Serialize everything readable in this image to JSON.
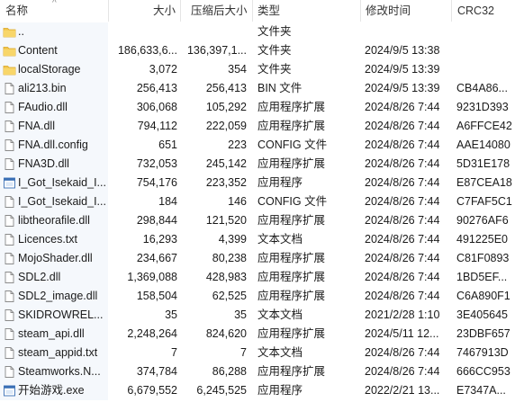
{
  "columns": {
    "name": "名称",
    "size": "大小",
    "compressed": "压缩后大小",
    "type": "类型",
    "modified": "修改时间",
    "crc": "CRC32"
  },
  "files": [
    {
      "name": "..",
      "size": "",
      "compressed": "",
      "type": "文件夹",
      "modified": "",
      "crc": "",
      "icon": "folder-icon"
    },
    {
      "name": "Content",
      "size": "186,633,6...",
      "compressed": "136,397,1...",
      "type": "文件夹",
      "modified": "2024/9/5 13:38",
      "crc": "",
      "icon": "folder-icon"
    },
    {
      "name": "localStorage",
      "size": "3,072",
      "compressed": "354",
      "type": "文件夹",
      "modified": "2024/9/5 13:39",
      "crc": "",
      "icon": "folder-icon"
    },
    {
      "name": "ali213.bin",
      "size": "256,413",
      "compressed": "256,413",
      "type": "BIN 文件",
      "modified": "2024/9/5 13:39",
      "crc": "CB4A86...",
      "icon": "file-icon"
    },
    {
      "name": "FAudio.dll",
      "size": "306,068",
      "compressed": "105,292",
      "type": "应用程序扩展",
      "modified": "2024/8/26 7:44",
      "crc": "9231D393",
      "icon": "file-icon"
    },
    {
      "name": "FNA.dll",
      "size": "794,112",
      "compressed": "222,059",
      "type": "应用程序扩展",
      "modified": "2024/8/26 7:44",
      "crc": "A6FFCE42",
      "icon": "file-icon"
    },
    {
      "name": "FNA.dll.config",
      "size": "651",
      "compressed": "223",
      "type": "CONFIG 文件",
      "modified": "2024/8/26 7:44",
      "crc": "AAE14080",
      "icon": "file-icon"
    },
    {
      "name": "FNA3D.dll",
      "size": "732,053",
      "compressed": "245,142",
      "type": "应用程序扩展",
      "modified": "2024/8/26 7:44",
      "crc": "5D31E178",
      "icon": "file-icon"
    },
    {
      "name": "I_Got_Isekaid_I...",
      "size": "754,176",
      "compressed": "223,352",
      "type": "应用程序",
      "modified": "2024/8/26 7:44",
      "crc": "E87CEA18",
      "icon": "exe-icon"
    },
    {
      "name": "I_Got_Isekaid_I...",
      "size": "184",
      "compressed": "146",
      "type": "CONFIG 文件",
      "modified": "2024/8/26 7:44",
      "crc": "C7FAF5C1",
      "icon": "file-icon"
    },
    {
      "name": "libtheorafile.dll",
      "size": "298,844",
      "compressed": "121,520",
      "type": "应用程序扩展",
      "modified": "2024/8/26 7:44",
      "crc": "90276AF6",
      "icon": "file-icon"
    },
    {
      "name": "Licences.txt",
      "size": "16,293",
      "compressed": "4,399",
      "type": "文本文档",
      "modified": "2024/8/26 7:44",
      "crc": "491225E0",
      "icon": "file-icon"
    },
    {
      "name": "MojoShader.dll",
      "size": "234,667",
      "compressed": "80,238",
      "type": "应用程序扩展",
      "modified": "2024/8/26 7:44",
      "crc": "C81F0893",
      "icon": "file-icon"
    },
    {
      "name": "SDL2.dll",
      "size": "1,369,088",
      "compressed": "428,983",
      "type": "应用程序扩展",
      "modified": "2024/8/26 7:44",
      "crc": "1BD5EF...",
      "icon": "file-icon"
    },
    {
      "name": "SDL2_image.dll",
      "size": "158,504",
      "compressed": "62,525",
      "type": "应用程序扩展",
      "modified": "2024/8/26 7:44",
      "crc": "C6A890F1",
      "icon": "file-icon"
    },
    {
      "name": "SKIDROWREL...",
      "size": "35",
      "compressed": "35",
      "type": "文本文档",
      "modified": "2021/2/28 1:10",
      "crc": "3E405645",
      "icon": "file-icon"
    },
    {
      "name": "steam_api.dll",
      "size": "2,248,264",
      "compressed": "824,620",
      "type": "应用程序扩展",
      "modified": "2024/5/11 12...",
      "crc": "23DBF657",
      "icon": "file-icon"
    },
    {
      "name": "steam_appid.txt",
      "size": "7",
      "compressed": "7",
      "type": "文本文档",
      "modified": "2024/8/26 7:44",
      "crc": "7467913D",
      "icon": "file-icon"
    },
    {
      "name": "Steamworks.N...",
      "size": "374,784",
      "compressed": "86,288",
      "type": "应用程序扩展",
      "modified": "2024/8/26 7:44",
      "crc": "666CC953",
      "icon": "file-icon"
    },
    {
      "name": "开始游戏.exe",
      "size": "6,679,552",
      "compressed": "6,245,525",
      "type": "应用程序",
      "modified": "2022/2/21 13...",
      "crc": "E7347A...",
      "icon": "exe-icon"
    }
  ]
}
